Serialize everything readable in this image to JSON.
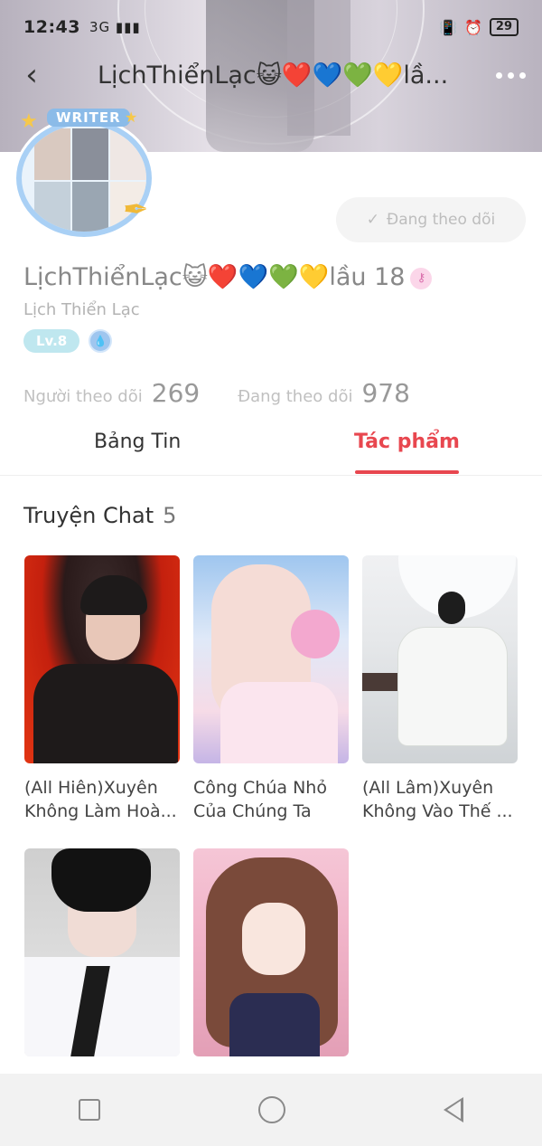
{
  "status_bar": {
    "time": "12:43",
    "signal": "3G ▮▮▮",
    "battery": "29"
  },
  "header": {
    "title": "LịchThiểnLạc😺❤️💙💚💛lầ...",
    "back_icon": "chevron-left-icon",
    "more_icon": "more-dots-icon"
  },
  "profile": {
    "avatar_badge": "WRITER",
    "display_name": "LịchThiểnLạc😺❤️💙💚💛lầu 18",
    "username": "Lịch Thiển Lạc",
    "level": "Lv.8",
    "follow_button_label": "Đang theo dõi",
    "followers_label": "Người theo dõi",
    "followers_count": "269",
    "following_label": "Đang theo dõi",
    "following_count": "978"
  },
  "tabs": {
    "news": "Bảng Tin",
    "works": "Tác phẩm",
    "active": "works"
  },
  "section": {
    "title": "Truyện Chat",
    "count": "5"
  },
  "stories": [
    {
      "line1": "(All Hiên)Xuyên",
      "line2": "Không Làm Hoà..."
    },
    {
      "line1": "Công Chúa Nhỏ",
      "line2": "Của Chúng Ta"
    },
    {
      "line1": "(All Lâm)Xuyên",
      "line2": "Không Vào Thế ..."
    },
    {
      "line1": "",
      "line2": ""
    },
    {
      "line1": "",
      "line2": ""
    }
  ],
  "colors": {
    "accent": "#e8474f",
    "level_badge": "#bfe7ef"
  }
}
